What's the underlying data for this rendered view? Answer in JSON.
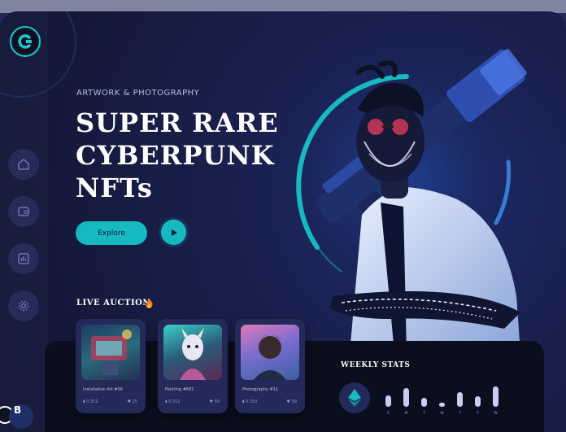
{
  "sidebar": {
    "logo_icon": "brand-logo",
    "nav": [
      {
        "icon": "home-icon"
      },
      {
        "icon": "wallet-icon"
      },
      {
        "icon": "chart-icon"
      },
      {
        "icon": "settings-icon"
      }
    ]
  },
  "hero": {
    "eyebrow": "ARTWORK & PHOTOGRAPHY",
    "title_line1": "SUPER RARE",
    "title_line2": "CYBERPUNK",
    "title_line3": "NFTs",
    "explore_label": "Explore",
    "play_icon": "play-icon"
  },
  "auction": {
    "title": "LIVE AUCTION",
    "cards": [
      {
        "title": "Installation Art #09",
        "price": "0.312",
        "likes": "25"
      },
      {
        "title": "Painting #881",
        "price": "0.312",
        "likes": "59"
      },
      {
        "title": "Photography #11",
        "price": "0.310",
        "likes": "59"
      }
    ]
  },
  "stats": {
    "title": "WEEKLY STATS",
    "days": [
      "S",
      "M",
      "T",
      "W",
      "T",
      "F",
      "W"
    ],
    "values": [
      0.55,
      0.9,
      0.45,
      0.2,
      0.7,
      0.5,
      1.0
    ]
  },
  "colors": {
    "accent": "#17b9c0",
    "bg": "#1a2150"
  }
}
